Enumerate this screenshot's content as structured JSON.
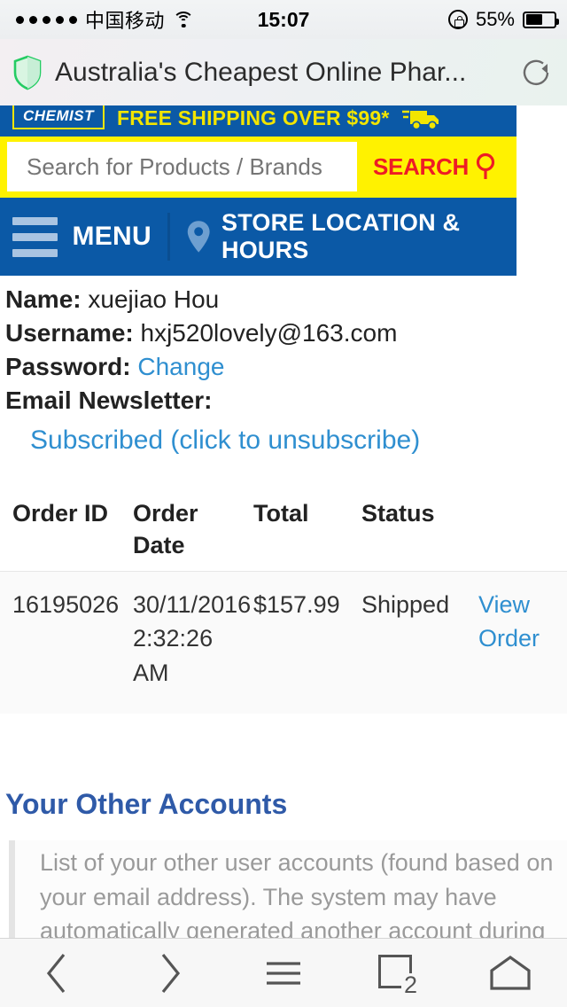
{
  "status_bar": {
    "signal_dots": 5,
    "carrier": "中国移动",
    "wifi_icon": "wifi-icon",
    "time": "15:07",
    "rotation_lock_icon": "rotation-lock-icon",
    "battery_percent": "55%",
    "battery_level": 55
  },
  "browser": {
    "shield_icon": "shield-icon",
    "page_title": "Australia's Cheapest Online Phar...",
    "reload_icon": "reload-icon",
    "toolbar": {
      "back_icon": "back-chevron-icon",
      "forward_icon": "forward-chevron-icon",
      "share_icon": "menu-lines-icon",
      "tabs_icon": "tabs-icon",
      "tabs_count": "2",
      "home_icon": "home-icon"
    }
  },
  "site": {
    "logo_text": "CHEMIST",
    "shipping_banner": "FREE SHIPPING OVER $99*",
    "truck_icon": "delivery-truck-icon",
    "search": {
      "placeholder": "Search for Products / Brands",
      "value": "",
      "button_label": "SEARCH",
      "magnifier_icon": "magnifier-icon"
    },
    "nav": {
      "burger_icon": "hamburger-menu-icon",
      "menu_label": "MENU",
      "pin_icon": "location-pin-icon",
      "store_label": "STORE LOCATION & HOURS"
    }
  },
  "account": {
    "name_label": "Name:",
    "name_value": "xuejiao Hou",
    "username_label": "Username:",
    "username_value": "hxj520lovely@163.com",
    "password_label": "Password:",
    "password_change_link": "Change",
    "newsletter_label": "Email Newsletter:",
    "newsletter_status_link": "Subscribed (click to unsubscribe)"
  },
  "orders": {
    "columns": [
      "Order ID",
      "Order Date",
      "Total",
      "Status",
      ""
    ],
    "rows": [
      {
        "order_id": "16195026",
        "order_date": "30/11/2016 2:32:26 AM",
        "total": "$157.99",
        "status": "Shipped",
        "action": "View Order"
      }
    ]
  },
  "other_accounts": {
    "heading": "Your Other Accounts",
    "description": "List of your other user accounts (found based on your email address). The system may have automatically generated another account during your PayPal checkout."
  },
  "colors": {
    "brand_blue": "#0b59a6",
    "brand_yellow": "#fff200",
    "accent_red": "#ee1c25",
    "link_blue": "#2f8fd0",
    "heading_blue": "#2f5aa8"
  }
}
